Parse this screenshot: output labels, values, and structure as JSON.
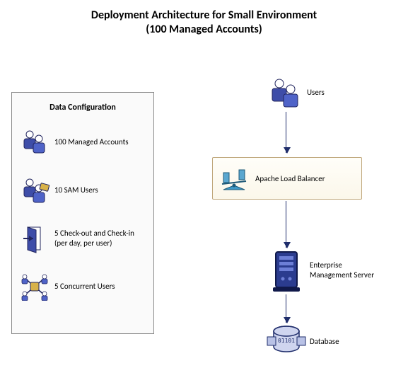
{
  "title_line1": "Deployment Architecture for Small Environment",
  "title_line2": "(100 Managed Accounts)",
  "config": {
    "heading": "Data Configuration",
    "items": [
      {
        "icon": "users-icon",
        "label": "100 Managed Accounts"
      },
      {
        "icon": "sam-user-icon",
        "label": "10 SAM Users"
      },
      {
        "icon": "door-icon",
        "label": "5 Check-out and Check-in\n(per day, per user)"
      },
      {
        "icon": "network-icon",
        "label": "5 Concurrent Users"
      }
    ]
  },
  "architecture": {
    "users_label": "Users",
    "load_balancer_label": "Apache Load Balancer",
    "ems_label": "Enterprise\nManagement Server",
    "database_label": "Database"
  },
  "chart_data": {
    "type": "table",
    "title": "Deployment Architecture for Small Environment (100 Managed Accounts)",
    "data_configuration": {
      "managed_accounts": 100,
      "sam_users": 10,
      "checkout_checkin_per_day_per_user": 5,
      "concurrent_users": 5
    },
    "flow": [
      "Users",
      "Apache Load Balancer",
      "Enterprise Management Server",
      "Database"
    ]
  }
}
